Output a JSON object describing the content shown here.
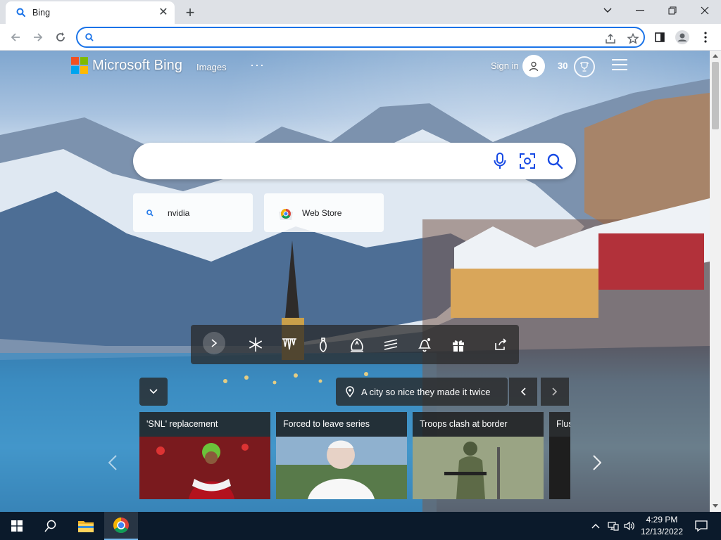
{
  "browser": {
    "tab_title": "Bing",
    "tab_close": "✕",
    "new_tab": "+",
    "address_value": ""
  },
  "bing": {
    "brand": "Microsoft Bing",
    "nav_images": "Images",
    "nav_more": "···",
    "sign_in": "Sign in",
    "points": "30",
    "quick_tiles": [
      {
        "label": "nvidia"
      },
      {
        "label": "Web Store"
      }
    ],
    "caption": "A city so nice they made it twice",
    "news": [
      {
        "headline": "'SNL' replacement"
      },
      {
        "headline": "Forced to leave series"
      },
      {
        "headline": "Troops clash at border"
      },
      {
        "headline": "Flus"
      }
    ]
  },
  "taskbar": {
    "time": "4:29 PM",
    "date": "12/13/2022"
  },
  "colors": {
    "chrome_accent": "#1a73e8",
    "tab_strip": "#dee1e6",
    "taskbar": "#0b1a2b",
    "ms_red": "#f25022",
    "ms_green": "#7fba00",
    "ms_blue": "#00a4ef",
    "ms_yellow": "#ffb900"
  }
}
